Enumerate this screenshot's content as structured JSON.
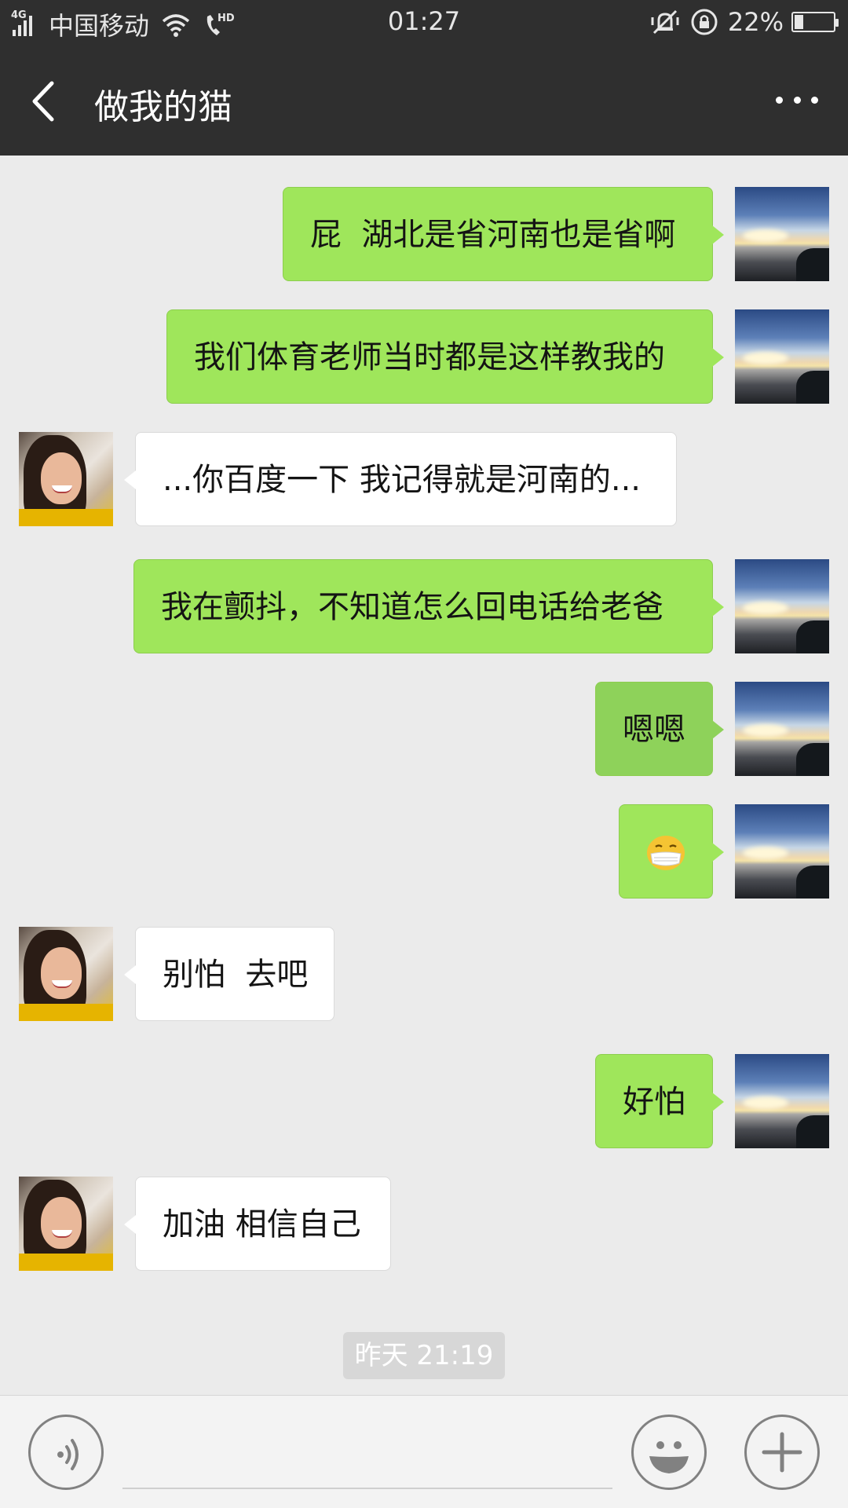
{
  "status_bar": {
    "network_type": "4G",
    "carrier": "中国移动",
    "hd_label": "HD",
    "time": "01:27",
    "battery_percent": "22%",
    "battery_level": 0.22
  },
  "header": {
    "back_icon": "chevron-left-icon",
    "title": "做我的猫",
    "more_icon": "more-dots-icon"
  },
  "messages": [
    {
      "sender": "me",
      "text": "屁  湖北是省河南也是省啊"
    },
    {
      "sender": "me",
      "text": "我们体育老师当时都是这样教我的"
    },
    {
      "sender": "her",
      "text": "...你百度一下 我记得就是河南的..."
    },
    {
      "sender": "me",
      "text": "我在颤抖，不知道怎么回电话给老爸"
    },
    {
      "sender": "me",
      "text": "嗯嗯"
    },
    {
      "sender": "me",
      "emoji": "mask-face-emoji"
    },
    {
      "sender": "her",
      "text": "别怕  去吧"
    },
    {
      "sender": "me",
      "text": "好怕"
    },
    {
      "sender": "her",
      "text": "加油 相信自己"
    }
  ],
  "timestamp": "昨天 21:19",
  "input_bar": {
    "voice_icon": "voice-icon",
    "emoji_icon": "emoji-icon",
    "plus_icon": "plus-icon"
  },
  "colors": {
    "my_bubble": "#9fe65b",
    "her_bubble": "#ffffff",
    "header_bg": "#2f2f2f",
    "chat_bg": "#ebebeb"
  }
}
